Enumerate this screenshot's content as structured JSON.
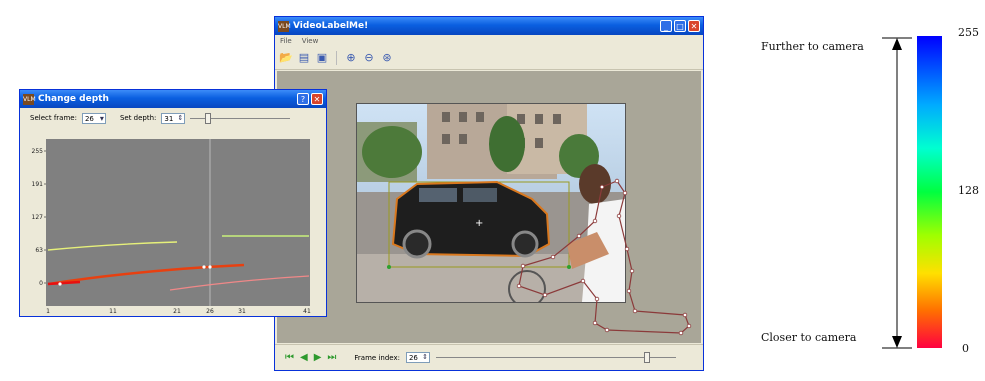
{
  "main_window": {
    "title": "VideoLabelMe!",
    "menu": [
      "File",
      "View"
    ],
    "toolbar_icons": [
      "open-icon",
      "folder-icon",
      "save-icon",
      "zoom-in-icon",
      "zoom-out-icon",
      "zoom-fit-icon"
    ],
    "frame_index_label": "Frame index:",
    "frame_index_value": "26",
    "frame_slider_position": 0.89
  },
  "dialog": {
    "title": "Change depth",
    "select_frame_label": "Select frame:",
    "select_frame_value": "26",
    "set_depth_label": "Set depth:",
    "set_depth_value": "31",
    "depth_slider_position": 0.16,
    "y_ticks": [
      "255",
      "191",
      "127",
      "63",
      "0"
    ],
    "x_ticks": [
      "1",
      "11",
      "21",
      "26",
      "31",
      "41"
    ]
  },
  "depth_scale": {
    "top_label": "Further to camera",
    "bottom_label": "Closer to camera",
    "max_value": "255",
    "mid_value": "128",
    "min_value": "0"
  }
}
